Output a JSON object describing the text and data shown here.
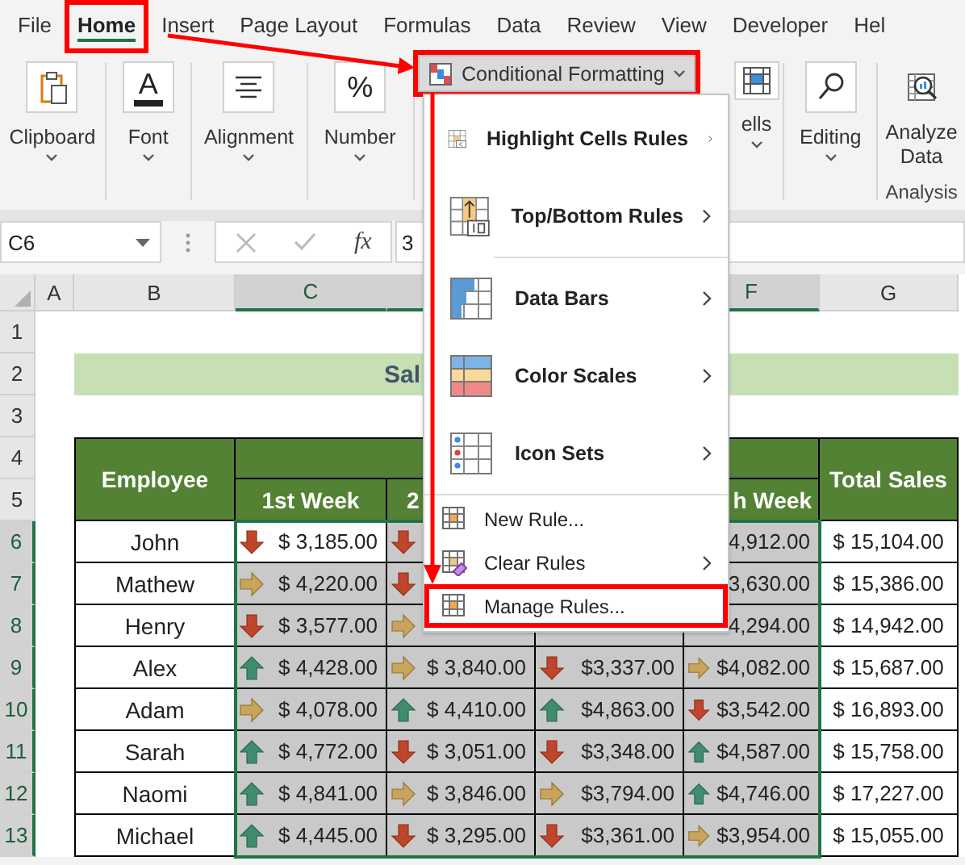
{
  "ribbon": {
    "tabs": [
      {
        "label": "File",
        "selected": false,
        "highlighted": false
      },
      {
        "label": "Home",
        "selected": true,
        "highlighted": true
      },
      {
        "label": "Insert",
        "selected": false,
        "highlighted": false
      },
      {
        "label": "Page Layout",
        "selected": false,
        "highlighted": false
      },
      {
        "label": "Formulas",
        "selected": false,
        "highlighted": false
      },
      {
        "label": "Data",
        "selected": false,
        "highlighted": false
      },
      {
        "label": "Review",
        "selected": false,
        "highlighted": false
      },
      {
        "label": "View",
        "selected": false,
        "highlighted": false
      },
      {
        "label": "Developer",
        "selected": false,
        "highlighted": false
      },
      {
        "label": "Hel",
        "selected": false,
        "highlighted": false
      }
    ],
    "groups": [
      {
        "kind": "clipboard",
        "label": "Clipboard"
      },
      {
        "kind": "font",
        "label": "Font",
        "glyph": "A"
      },
      {
        "kind": "alignment",
        "label": "Alignment"
      },
      {
        "kind": "number",
        "label": "Number",
        "glyph": "%"
      },
      {
        "kind": "conditional_formatting",
        "label": "Conditional Formatting",
        "expanded": true,
        "highlighted": true
      },
      {
        "kind": "cells",
        "label": "ells"
      },
      {
        "kind": "editing",
        "label": "Editing"
      },
      {
        "kind": "analyze",
        "label": "Analyze Data",
        "group_label": "Analysis"
      }
    ]
  },
  "formula_bar": {
    "name_box": "C6",
    "function_glyph": "fx",
    "value": "3"
  },
  "sheet": {
    "columns": [
      {
        "label": "A",
        "selected": false
      },
      {
        "label": "B",
        "selected": false
      },
      {
        "label": "C",
        "selected": true
      },
      {
        "selected": true
      },
      {
        "label": "F",
        "selected": true
      },
      {
        "label": "G",
        "selected": false
      }
    ],
    "rows": [
      {
        "label": "1",
        "selected": false
      },
      {
        "label": "2",
        "selected": false
      },
      {
        "label": "3",
        "selected": false
      },
      {
        "label": "4",
        "selected": false
      },
      {
        "label": "5",
        "selected": false
      },
      {
        "label": "6",
        "selected": true
      },
      {
        "label": "7",
        "selected": true
      },
      {
        "label": "8",
        "selected": true
      },
      {
        "label": "9",
        "selected": true
      },
      {
        "label": "10",
        "selected": true
      },
      {
        "label": "11",
        "selected": true
      },
      {
        "label": "12",
        "selected": true
      },
      {
        "label": "13",
        "selected": true
      }
    ],
    "title": "Sal",
    "employee_header": "Employee",
    "week_headers": {
      "c": "1st Week",
      "d": "2",
      "f": "h Week"
    },
    "total_header": "Total Sales",
    "records": [
      {
        "employee": "John",
        "cells": {
          "c": {
            "kind": "down",
            "amount": "$ 3,185.00",
            "active": true
          },
          "d": {
            "kind": "down",
            "active": false
          },
          "f": {
            "amount": "4,912.00",
            "active": false
          }
        },
        "total": "$ 15,104.00"
      },
      {
        "employee": "Mathew",
        "cells": {
          "c": {
            "kind": "flat",
            "amount": "$ 4,220.00",
            "active": false
          },
          "d": {
            "kind": "down",
            "active": false
          },
          "f": {
            "amount": "3,630.00",
            "active": false
          }
        },
        "total": "$ 15,386.00"
      },
      {
        "employee": "Henry",
        "cells": {
          "c": {
            "kind": "down",
            "amount": "$ 3,577.00",
            "active": false
          },
          "d": {
            "kind": "flat",
            "active": false
          },
          "f": {
            "amount": "4,294.00",
            "active": false
          }
        },
        "total": "$ 14,942.00"
      },
      {
        "employee": "Alex",
        "cells": {
          "c": {
            "kind": "up",
            "amount": "$ 4,428.00",
            "active": false
          },
          "d": {
            "kind": "flat",
            "amount": "$ 3,840.00",
            "active": false
          },
          "e": {
            "kind": "down",
            "amount": "$3,337.00",
            "active": false
          },
          "f": {
            "kind": "flat",
            "amount": "$4,082.00",
            "active": false
          }
        },
        "total": "$ 15,687.00"
      },
      {
        "employee": "Adam",
        "cells": {
          "c": {
            "kind": "flat",
            "amount": "$ 4,078.00",
            "active": false
          },
          "d": {
            "kind": "up",
            "amount": "$ 4,410.00",
            "active": false
          },
          "e": {
            "kind": "up",
            "amount": "$4,863.00",
            "active": false
          },
          "f": {
            "kind": "down",
            "amount": "$3,542.00",
            "active": false
          }
        },
        "total": "$ 16,893.00"
      },
      {
        "employee": "Sarah",
        "cells": {
          "c": {
            "kind": "up",
            "amount": "$ 4,772.00",
            "active": false
          },
          "d": {
            "kind": "down",
            "amount": "$ 3,051.00",
            "active": false
          },
          "e": {
            "kind": "down",
            "amount": "$3,348.00",
            "active": false
          },
          "f": {
            "kind": "up",
            "amount": "$4,587.00",
            "active": false
          }
        },
        "total": "$ 15,758.00"
      },
      {
        "employee": "Naomi",
        "cells": {
          "c": {
            "kind": "up",
            "amount": "$ 4,841.00",
            "active": false
          },
          "d": {
            "kind": "flat",
            "amount": "$ 3,846.00",
            "active": false
          },
          "e": {
            "kind": "flat",
            "amount": "$3,794.00",
            "active": false
          },
          "f": {
            "kind": "up",
            "amount": "$4,746.00",
            "active": false
          }
        },
        "total": "$ 17,227.00"
      },
      {
        "employee": "Michael",
        "cells": {
          "c": {
            "kind": "up",
            "amount": "$ 4,445.00",
            "active": false
          },
          "d": {
            "kind": "down",
            "amount": "$ 3,295.00",
            "active": false
          },
          "e": {
            "kind": "down",
            "amount": "$3,361.00",
            "active": false
          },
          "f": {
            "kind": "flat",
            "amount": "$3,954.00",
            "active": false
          }
        },
        "total": "$ 15,055.00"
      }
    ]
  },
  "menu": {
    "items": [
      {
        "kind": "large",
        "label": "Highlight Cells Rules",
        "submenu": true,
        "highlighted": false
      },
      {
        "kind": "large",
        "label": "Top/Bottom Rules",
        "submenu": true,
        "highlighted": false
      },
      {
        "kind": "separator"
      },
      {
        "kind": "large",
        "label": "Data Bars",
        "submenu": true,
        "highlighted": false
      },
      {
        "kind": "large",
        "label": "Color Scales",
        "submenu": true,
        "highlighted": false
      },
      {
        "kind": "large",
        "label": "Icon Sets",
        "submenu": true,
        "highlighted": false
      },
      {
        "kind": "separator"
      },
      {
        "kind": "small",
        "label": "New Rule...",
        "submenu": false,
        "highlighted": false
      },
      {
        "kind": "small",
        "label": "Clear Rules",
        "submenu": true,
        "highlighted": false
      },
      {
        "kind": "small",
        "label": "Manage Rules...",
        "submenu": false,
        "highlighted": true
      }
    ]
  }
}
